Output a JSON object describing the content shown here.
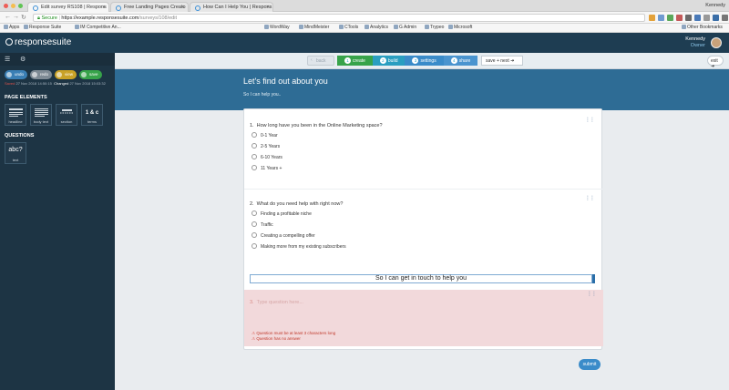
{
  "browser": {
    "tabs": [
      {
        "label": "Edit survey RS108 | Respons"
      },
      {
        "label": "Free Landing Pages Creato"
      },
      {
        "label": "How Can I Help You | Respons"
      }
    ],
    "profile": "Kennedy",
    "secure_label": "Secure",
    "url_host": "https://example.responsesuite.com",
    "url_path": "/surveys/108/edit",
    "bookmarks": [
      "Apps",
      "Response Suite",
      "IM Competitive An...",
      "WordWay",
      "MindMeister",
      "CTools",
      "Analytics",
      "G Admin",
      "Trypeo",
      "Microsoft",
      "Other Bookmarks"
    ]
  },
  "app": {
    "logo": "responsesuite",
    "user_name": "Kennedy",
    "user_role": "Owner"
  },
  "sidebar": {
    "pills": [
      {
        "label": "undo",
        "color": "#3a7fb5"
      },
      {
        "label": "redo",
        "color": "#7f8b95"
      },
      {
        "label": "view",
        "color": "#c9a227"
      },
      {
        "label": "save",
        "color": "#37a34a"
      }
    ],
    "saved_label": "Saved",
    "saved_time": "27 Nov 2018 14:50:15",
    "changed_label": "Changed",
    "changed_time": "27 Nov 2018 15:03:32",
    "page_elements_title": "PAGE ELEMENTS",
    "page_elements": [
      {
        "label": "headline"
      },
      {
        "label": "body text"
      },
      {
        "label": "section"
      },
      {
        "label": "terms",
        "glyph": "1 & c"
      }
    ],
    "questions_title": "QUESTIONS",
    "question_tiles": [
      {
        "label": "text",
        "glyph": "abc?"
      }
    ]
  },
  "stepbar": {
    "back": "back",
    "steps": [
      {
        "num": "1",
        "label": "create",
        "color": "#37a34a"
      },
      {
        "num": "2",
        "label": "build",
        "color": "#2a9ec0"
      },
      {
        "num": "3",
        "label": "settings",
        "color": "#3a8bc9"
      },
      {
        "num": "4",
        "label": "share",
        "color": "#4a94cf"
      }
    ],
    "save_next": "save + next",
    "exit": "exit"
  },
  "page": {
    "title": "Let's find out about you",
    "subtitle": "So I can help you..",
    "questions": [
      {
        "number": "1.",
        "text": "How long have you been in the Online Marketing space?",
        "options": [
          "0-1 Year",
          "2-5 Years",
          "6-10 Years",
          "11 Years +"
        ]
      },
      {
        "number": "2.",
        "text": "What do you need help with right now?",
        "options": [
          "Finding a profitable niche",
          "Traffic",
          "Creating a compelling offer",
          "Making more from my existing subscribers"
        ]
      }
    ],
    "textbox_value": "So I can get in touch to help you",
    "new_question": {
      "number": "3.",
      "placeholder": "Type question here...",
      "errors": [
        "Question must be at least 3 characters long",
        "Question has no answer"
      ]
    },
    "submit": "submit"
  }
}
